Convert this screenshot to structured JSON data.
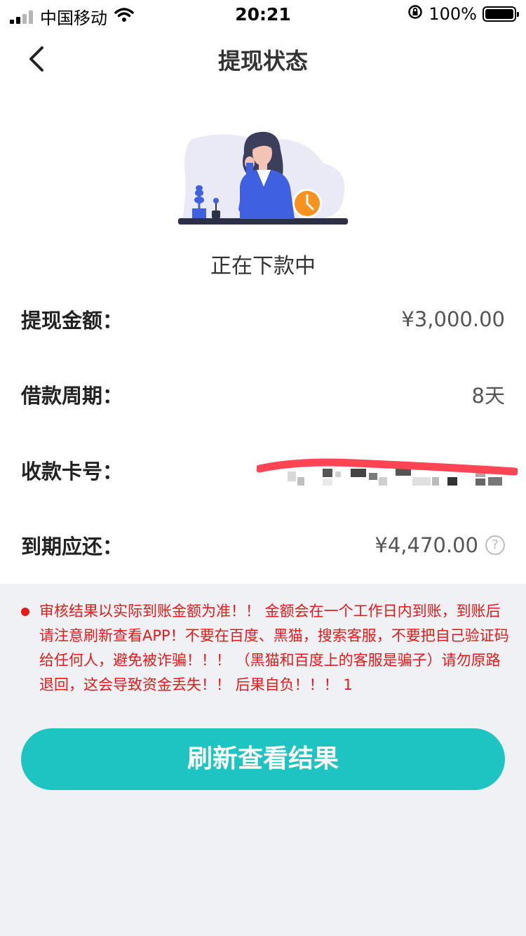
{
  "status_bar": {
    "carrier": "中国移动",
    "time": "20:21",
    "battery_percent": "100%",
    "icons": [
      "signal-icon",
      "wifi-icon",
      "orientation-lock-icon",
      "battery-icon"
    ]
  },
  "nav": {
    "title": "提现状态",
    "back_icon": "chevron-left-icon"
  },
  "status": {
    "text": "正在下款中",
    "illustration": "woman-waiting-clock-illustration"
  },
  "details": [
    {
      "label": "提现金额：",
      "value": "¥3,000.00"
    },
    {
      "label": "借款周期：",
      "value": "8天"
    },
    {
      "label": "收款卡号：",
      "value": ""
    },
    {
      "label": "到期应还：",
      "value": "¥4,470.00",
      "help_icon": "?"
    }
  ],
  "notice": {
    "text": "审核结果以实际到账金额为准！！ 金额会在一个工作日内到账，到账后请注意刷新查看APP！不要在百度、黑猫，搜索客服，不要把自己验证码给任何人，避免被诈骗！！！ （黑猫和百度上的客服是骗子）请勿原路退回，这会导致资金丢失！！ 后果自负！！！ 1"
  },
  "button": {
    "label": "刷新查看结果"
  },
  "colors": {
    "accent": "#1dc4c1",
    "warning": "#e81919",
    "background": "#f0f1f5"
  }
}
